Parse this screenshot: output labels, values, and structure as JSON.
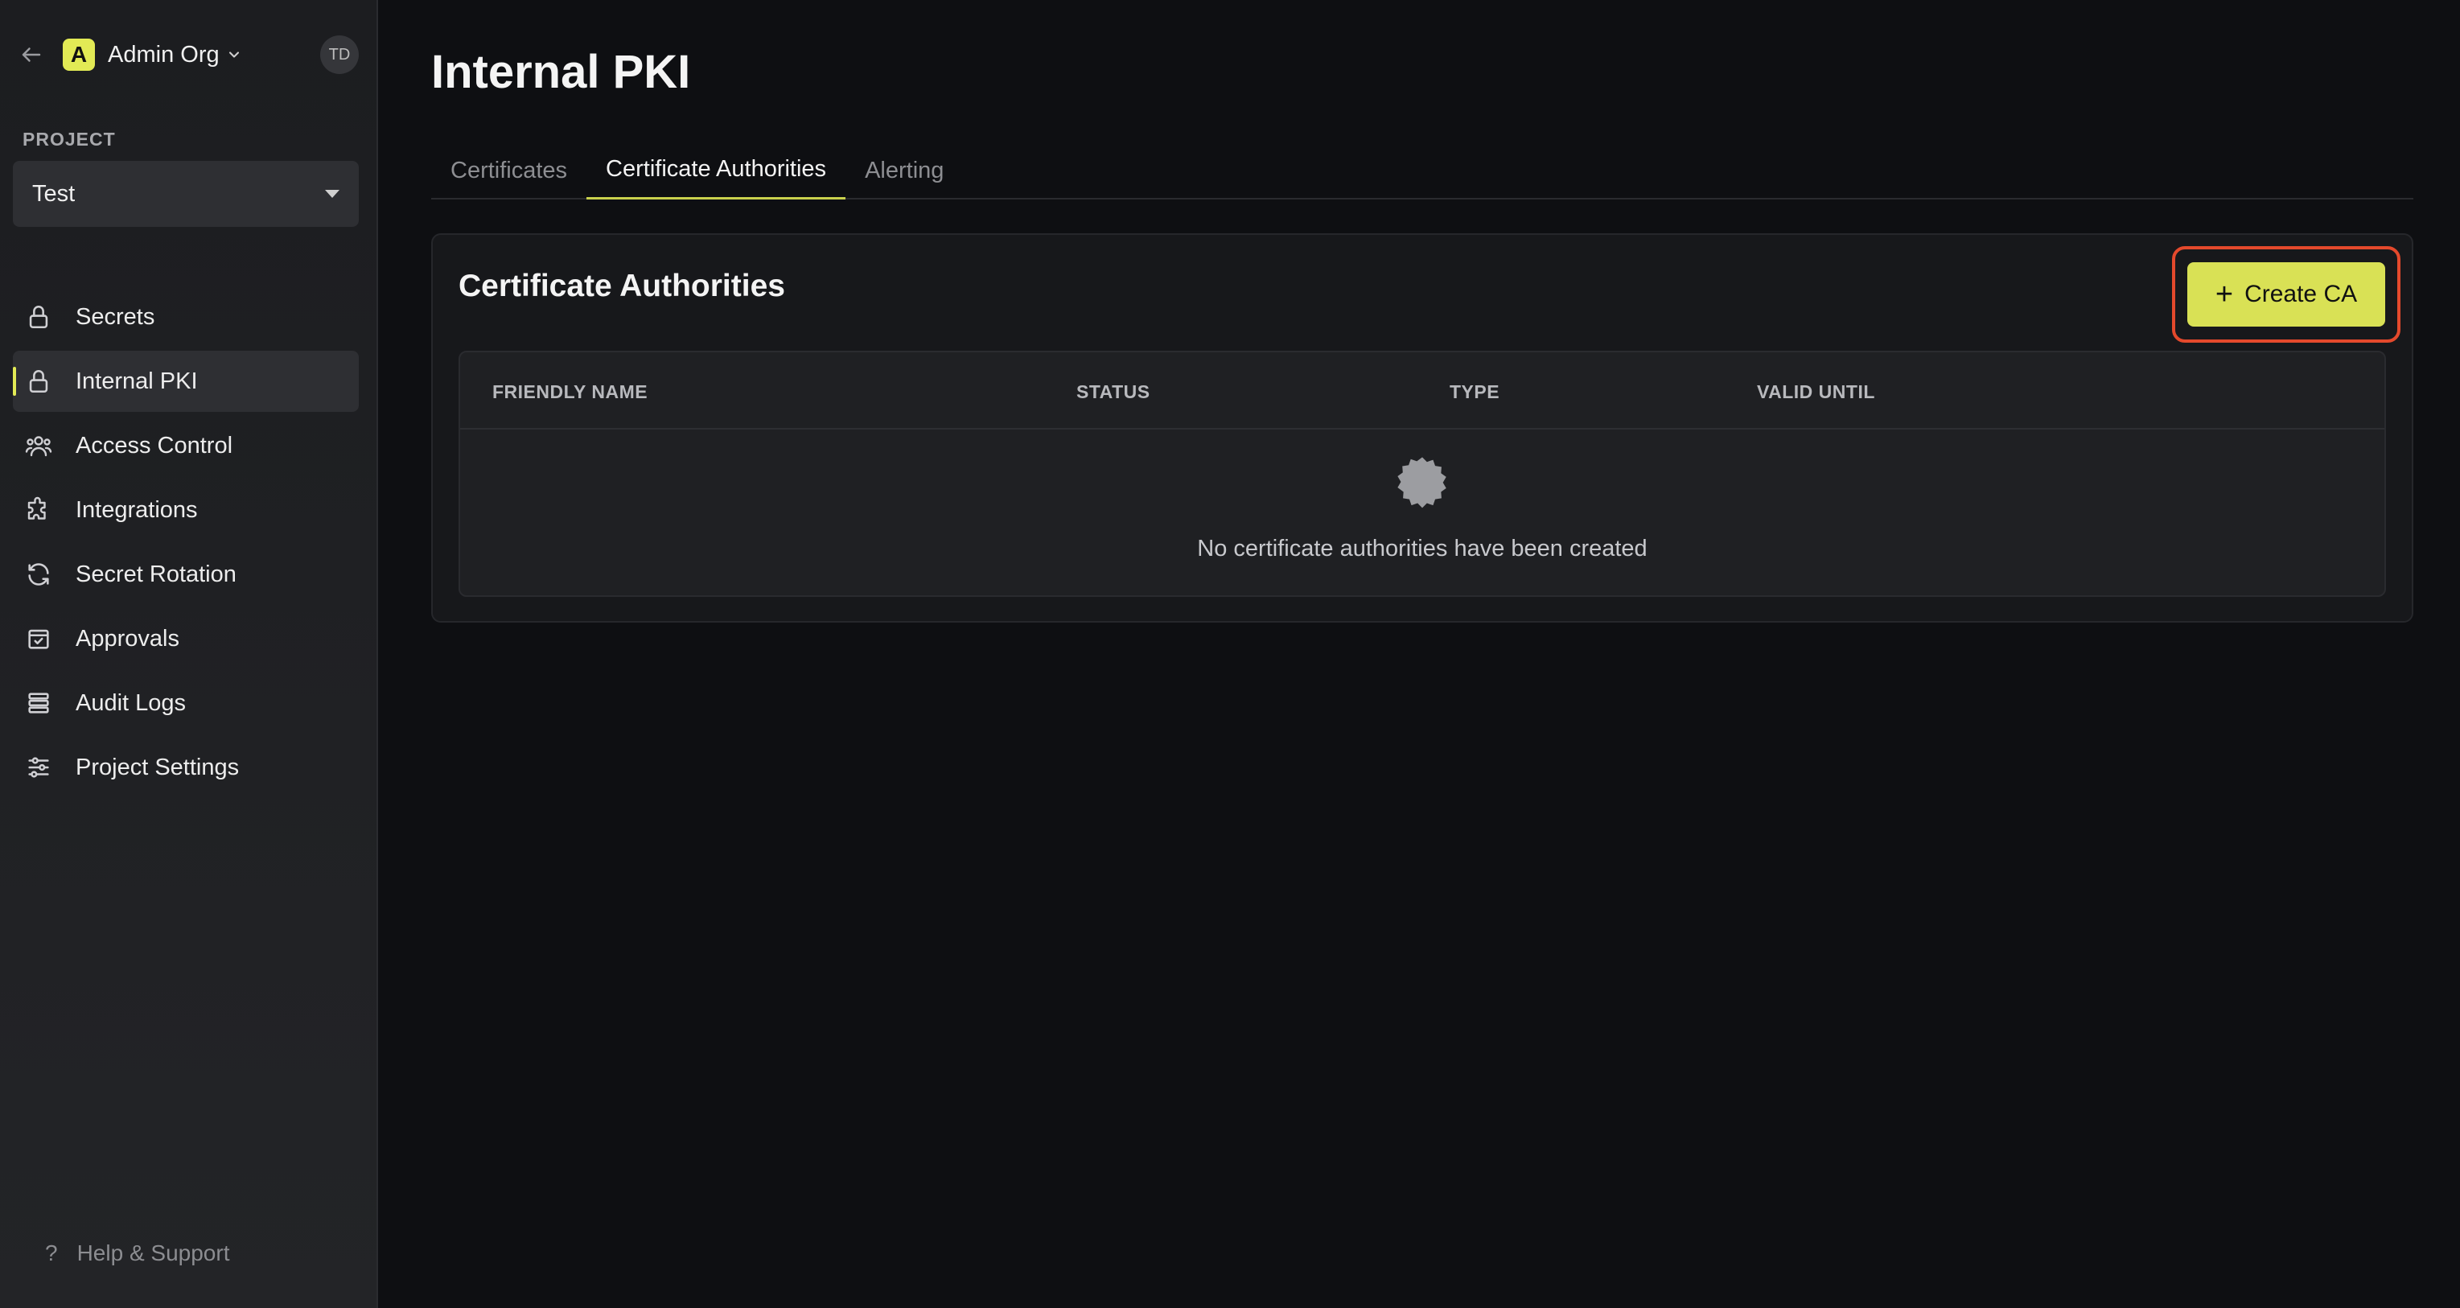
{
  "sidebar": {
    "org": {
      "logo_letter": "A",
      "name": "Admin Org",
      "avatar_initials": "TD"
    },
    "project": {
      "label": "PROJECT",
      "selected": "Test"
    },
    "items": [
      {
        "label": "Secrets",
        "icon": "lock-icon"
      },
      {
        "label": "Internal PKI",
        "icon": "lock-icon",
        "active": true
      },
      {
        "label": "Access Control",
        "icon": "users-icon"
      },
      {
        "label": "Integrations",
        "icon": "puzzle-icon"
      },
      {
        "label": "Secret Rotation",
        "icon": "refresh-icon"
      },
      {
        "label": "Approvals",
        "icon": "calendar-check-icon"
      },
      {
        "label": "Audit Logs",
        "icon": "list-icon"
      },
      {
        "label": "Project Settings",
        "icon": "sliders-icon"
      }
    ],
    "help": "Help & Support"
  },
  "main": {
    "title": "Internal PKI",
    "tabs": [
      {
        "label": "Certificates"
      },
      {
        "label": "Certificate Authorities",
        "active": true
      },
      {
        "label": "Alerting"
      }
    ],
    "card": {
      "title": "Certificate Authorities",
      "create_button": "Create CA",
      "columns": [
        "FRIENDLY NAME",
        "STATUS",
        "TYPE",
        "VALID UNTIL"
      ],
      "empty_message": "No certificate authorities have been created"
    }
  },
  "colors": {
    "accent": "#d9e155",
    "highlight": "#e4492c",
    "background": "#0e0f12"
  }
}
